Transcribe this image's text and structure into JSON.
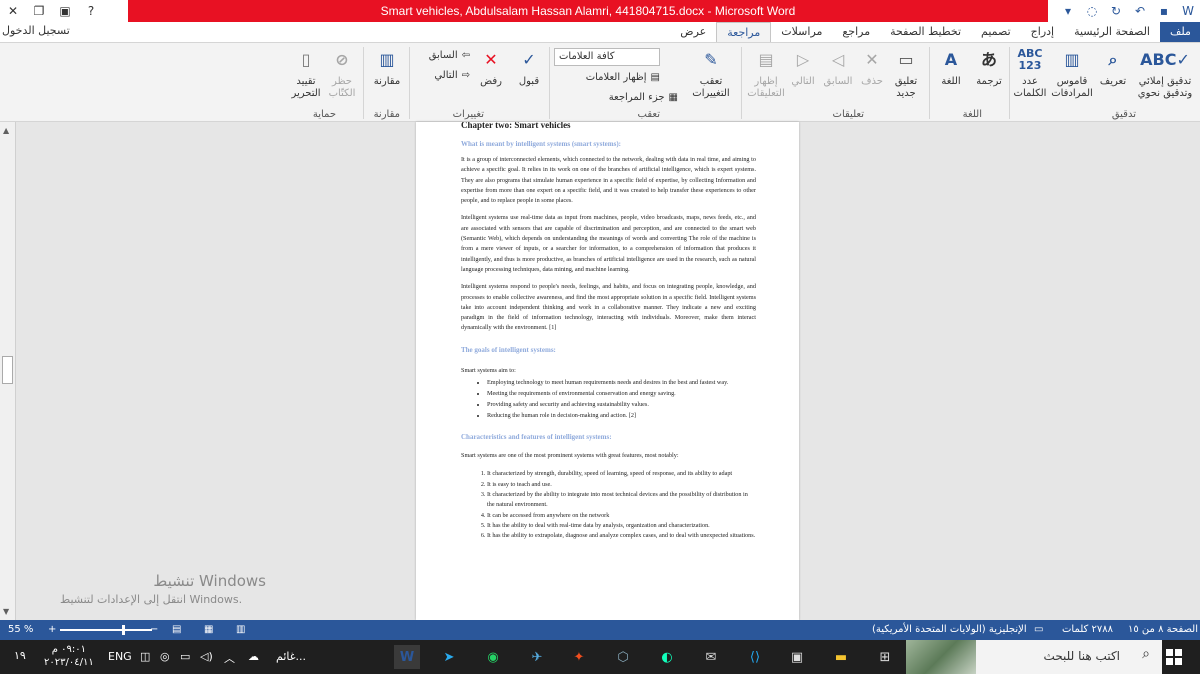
{
  "window": {
    "title": "Smart vehicles, Abdulsalam Hassan Alamri, 441804715.docx  -  Microsoft Word",
    "sign_in": "تسجيل الدخول",
    "buttons": {
      "close": "✕",
      "restore": "❐",
      "minimize": "—",
      "help": "?"
    }
  },
  "tabs": [
    "ملف",
    "الصفحة الرئيسية",
    "إدراج",
    "تصميم",
    "تخطيط الصفحة",
    "مراجع",
    "مراسلات",
    "مراجعة",
    "عرض"
  ],
  "active_tab": "مراجعة",
  "ribbon": {
    "groups": {
      "proofing": "تدقيق",
      "language": "اللغة",
      "comments": "تعليقات",
      "tracking": "تعقب",
      "changes": "تغييرات",
      "compare": "مقارنة",
      "protect": "حماية"
    },
    "buttons": {
      "spelling": "تدقيق إملائي وتدقيق نحوي",
      "define": "تعريف",
      "thesaurus": "قاموس المرادفات",
      "word_count": "عدد الكلمات",
      "translate": "ترجمة",
      "language": "اللغة",
      "new_comment": "تعليق جديد",
      "delete": "حذف",
      "previous": "السابق",
      "next": "التالي",
      "show_comments": "إظهار التعليقات",
      "track_changes": "تعقب التغييرات",
      "all_markup": "كافة العلامات",
      "show_markup": "إظهار العلامات",
      "reviewing_pane": "جزء المراجعة",
      "accept": "قبول",
      "reject": "رفض",
      "prev_change": "السابق",
      "next_change": "التالي",
      "compare": "مقارنة",
      "block_authors": "حظر الكتّاب",
      "restrict_editing": "تقييد التحرير"
    }
  },
  "document": {
    "chapter": "Chapter two: Smart vehicles",
    "heading1": "What is meant by intelligent systems (smart systems):",
    "para1": "It is a group of interconnected elements, which connected to the network, dealing with data in real time, and aiming to achieve a specific goal. It relies in its work on one of the branches of artificial intelligence, which is expert systems. They are also programs that simulate human experience in a specific field of expertise, by collecting Information and expertise from more than one expert on a specific field, and it was created to help transfer these experiences to other people, and to replace people in some places.",
    "para2": "Intelligent systems use real-time data as input from machines, people, video broadcasts, maps, news feeds, etc., and are associated with sensors that are capable of discrimination and perception, and are connected to the smart web (Semantic Web), which depends on understanding the meanings of words and converting The role of the machine is from a mere viewer of inputs, or a searcher for information, to a comprehension of information that produces it intelligently, and thus is more productive, as branches of artificial intelligence are used in the research, such as natural language processing techniques, data mining, and machine learning.",
    "para3": "Intelligent systems respond to people's needs, feelings, and habits, and focus on integrating people, knowledge, and processes to enable collective awareness, and find the most appropriate solution in a specific field. Intelligent systems take into account independent thinking and work in a collaborative manner. They indicate a new and exciting paradigm in the field of information technology, interacting with individuals. Moreover, make them interact dynamically with the environment. [1]",
    "heading2": "The goals of intelligent systems:",
    "goals_intro": "Smart systems aim to:",
    "goals": [
      "Employing technology to meet human requirements needs and desires in the best and fastest way.",
      "Meeting the requirements of environmental conservation and energy saving.",
      "Providing safety and security and achieving sustainability values.",
      "Reducing the human role in decision-making and action. [2]"
    ],
    "heading3": "Characteristics and features of intelligent systems:",
    "features_intro": "Smart systems are one of the most prominent systems with great features, most notably:",
    "features": [
      "It characterized by strength, durability, speed of learning, speed of response, and its ability to adapt",
      "It is easy to teach and use.",
      "It characterized by the ability to integrate into most technical devices and the possibility of distribution in the natural environment.",
      "It can be accessed from anywhere on the network",
      "It has the ability to deal with real-time data by analysis, organization and characterization.",
      "It has the ability to extrapolate, diagnose and analyze complex cases, and to deal with unexpected situations."
    ]
  },
  "watermark": {
    "line1": "تنشيط Windows",
    "line2": "انتقل إلى الإعدادات لتنشيط Windows."
  },
  "status": {
    "page": "الصفحة ٨ من ١٥",
    "words": "٢٧٨٨ كلمات",
    "language": "الإنجليزية (الولايات المتحدة الأمريكية)",
    "zoom": "55 %",
    "zoom_value_percent": 55
  },
  "taskbar": {
    "search_placeholder": "اكتب هنا للبحث",
    "time": "٠٩:٠١ م",
    "date": "٢٠٢٣/٠٤/١١",
    "lang": "ENG",
    "weather": "غائم...",
    "notif_count": "١٩",
    "telegram_badge": "13"
  },
  "colors": {
    "word_blue": "#2b579a",
    "title_red": "#e81123",
    "heading_blue": "#8faadc"
  }
}
